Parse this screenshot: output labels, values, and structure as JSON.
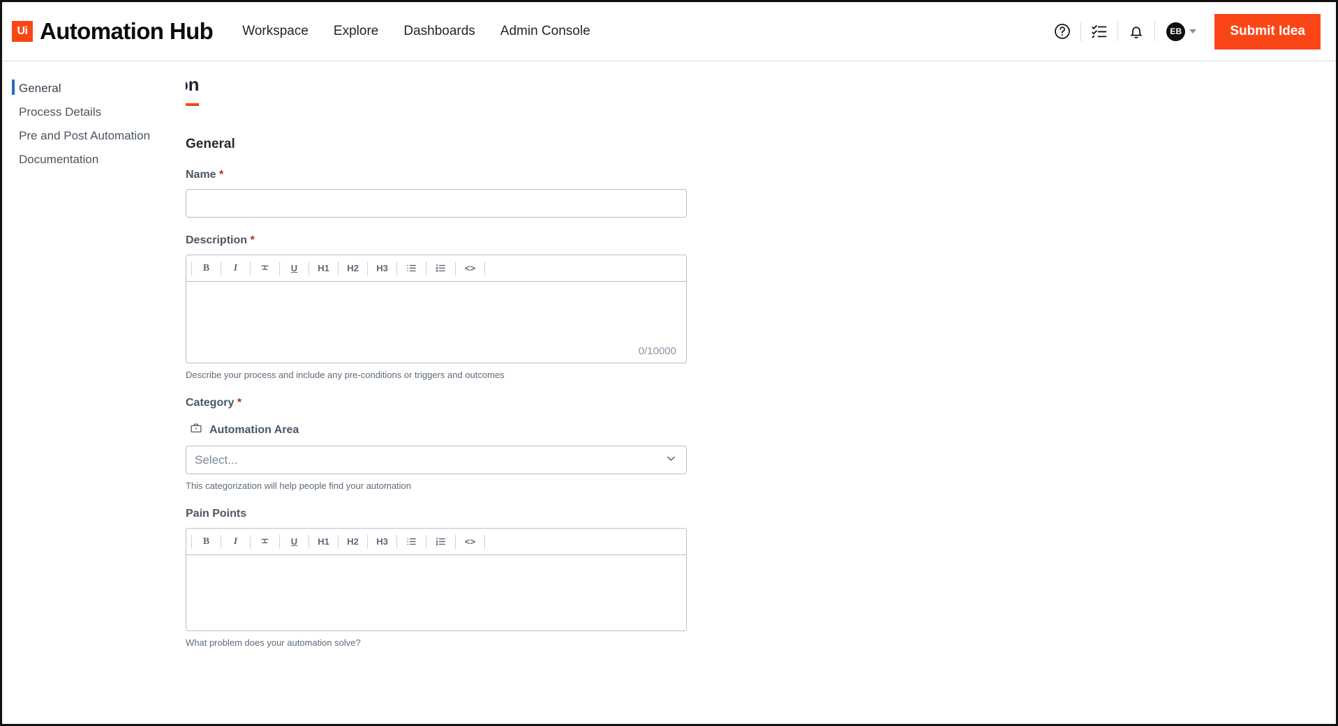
{
  "brand": {
    "mark": "Ui",
    "name": "Automation Hub",
    "accent_color": "#fa4616"
  },
  "nav": {
    "items": [
      {
        "label": "Workspace"
      },
      {
        "label": "Explore"
      },
      {
        "label": "Dashboards"
      },
      {
        "label": "Admin Console"
      }
    ]
  },
  "header_actions": {
    "help_icon": "help-circle-icon",
    "tasks_icon": "checklist-icon",
    "notifications_icon": "bell-icon",
    "avatar_initials": "EB",
    "submit_label": "Submit Idea"
  },
  "sidebar": {
    "items": [
      {
        "label": "General",
        "active": true
      },
      {
        "label": "Process Details",
        "active": false
      },
      {
        "label": "Pre and Post Automation",
        "active": false
      },
      {
        "label": "Documentation",
        "active": false
      }
    ]
  },
  "page": {
    "title": "Share your Automation",
    "section_title": "General"
  },
  "form": {
    "name": {
      "label": "Name",
      "required_mark": "*",
      "value": "",
      "placeholder": ""
    },
    "description": {
      "label": "Description",
      "required_mark": "*",
      "counter": "0/10000",
      "helper": "Describe your process and include any pre-conditions or triggers and outcomes",
      "value": ""
    },
    "category": {
      "label": "Category",
      "required_mark": "*",
      "area_icon": "briefcase-icon",
      "area_label": "Automation Area",
      "select_value": "Select...",
      "helper": "This categorization will help people find your automation"
    },
    "pain_points": {
      "label": "Pain Points",
      "helper": "What problem does your automation solve?",
      "value": ""
    }
  },
  "editor_toolbar": {
    "buttons": [
      {
        "label": "B",
        "name": "bold"
      },
      {
        "label": "I",
        "name": "italic"
      },
      {
        "label": "S",
        "name": "strikethrough"
      },
      {
        "label": "U",
        "name": "underline"
      },
      {
        "label": "H1",
        "name": "heading-1"
      },
      {
        "label": "H2",
        "name": "heading-2"
      },
      {
        "label": "H3",
        "name": "heading-3"
      },
      {
        "label": "☰",
        "name": "bullet-list"
      },
      {
        "label": "☰",
        "name": "numbered-list"
      },
      {
        "label": "<>",
        "name": "code-block"
      }
    ]
  }
}
